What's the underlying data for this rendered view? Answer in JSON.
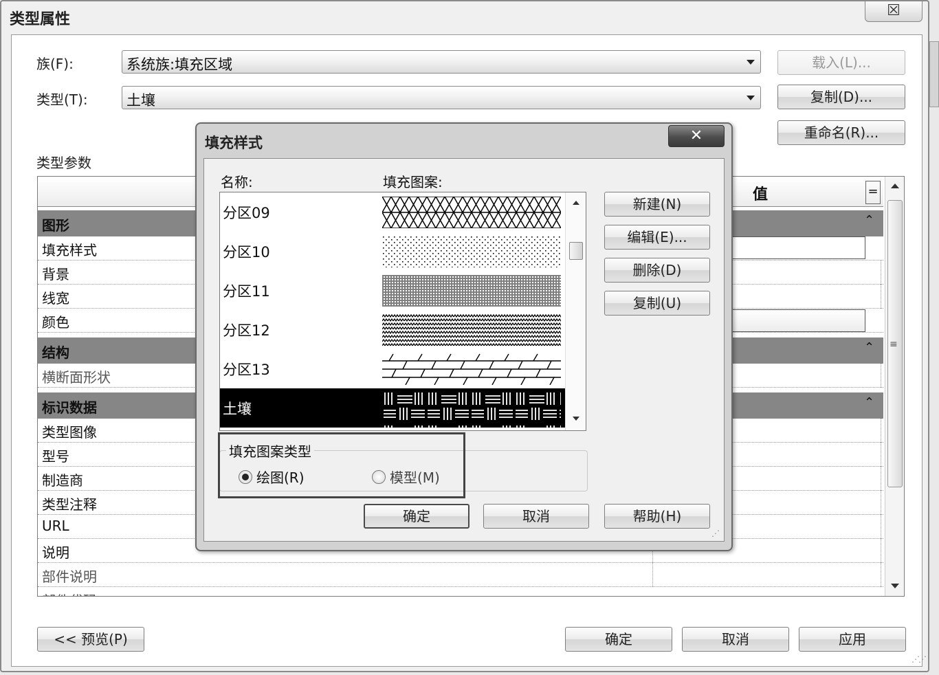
{
  "outer": {
    "title": "类型属性",
    "close_glyph": "☒",
    "family_label": "族(F):",
    "family_value": "系统族:填充区域",
    "type_label": "类型(T):",
    "type_value": "土壤",
    "load_button": "载入(L)...",
    "duplicate_button": "复制(D)...",
    "rename_button": "重命名(R)...",
    "type_params_label": "类型参数",
    "grid": {
      "value_header": "值",
      "eq_button": "=",
      "groups": [
        {
          "name": "图形",
          "chevron": "⌃"
        },
        {
          "name": "结构",
          "chevron": "⌃"
        },
        {
          "name": "标识数据",
          "chevron": "⌃"
        }
      ],
      "graphics_params": [
        "填充样式",
        "背景",
        "线宽",
        "颜色"
      ],
      "structure_params": [
        "横断面形状"
      ],
      "identity_params": [
        "类型图像",
        "型号",
        "制造商",
        "类型注释",
        "URL",
        "说明",
        "部件说明",
        "部件代码"
      ]
    },
    "preview_button": "<< 预览(P)",
    "ok_button": "确定",
    "cancel_button": "取消",
    "apply_button": "应用"
  },
  "inner": {
    "title": "填充样式",
    "close_glyph": "✕",
    "name_header": "名称:",
    "pattern_header": "填充图案:",
    "items": [
      {
        "name": "分区09",
        "pattern": "cross-hatch"
      },
      {
        "name": "分区10",
        "pattern": "dots"
      },
      {
        "name": "分区11",
        "pattern": "fine-lines"
      },
      {
        "name": "分区12",
        "pattern": "zigzag"
      },
      {
        "name": "分区13",
        "pattern": "diagonal-lines"
      },
      {
        "name": "土壤",
        "pattern": "brick",
        "selected": true
      }
    ],
    "new_button": "新建(N)",
    "edit_button": "编辑(E)...",
    "delete_button": "删除(D)",
    "copy_button": "复制(U)",
    "pattern_type_legend": "填充图案类型",
    "radio_drafting": "绘图(R)",
    "radio_model": "模型(M)",
    "radio_selected": "drafting",
    "ok_button": "确定",
    "cancel_button": "取消",
    "help_button": "帮助(H)"
  }
}
